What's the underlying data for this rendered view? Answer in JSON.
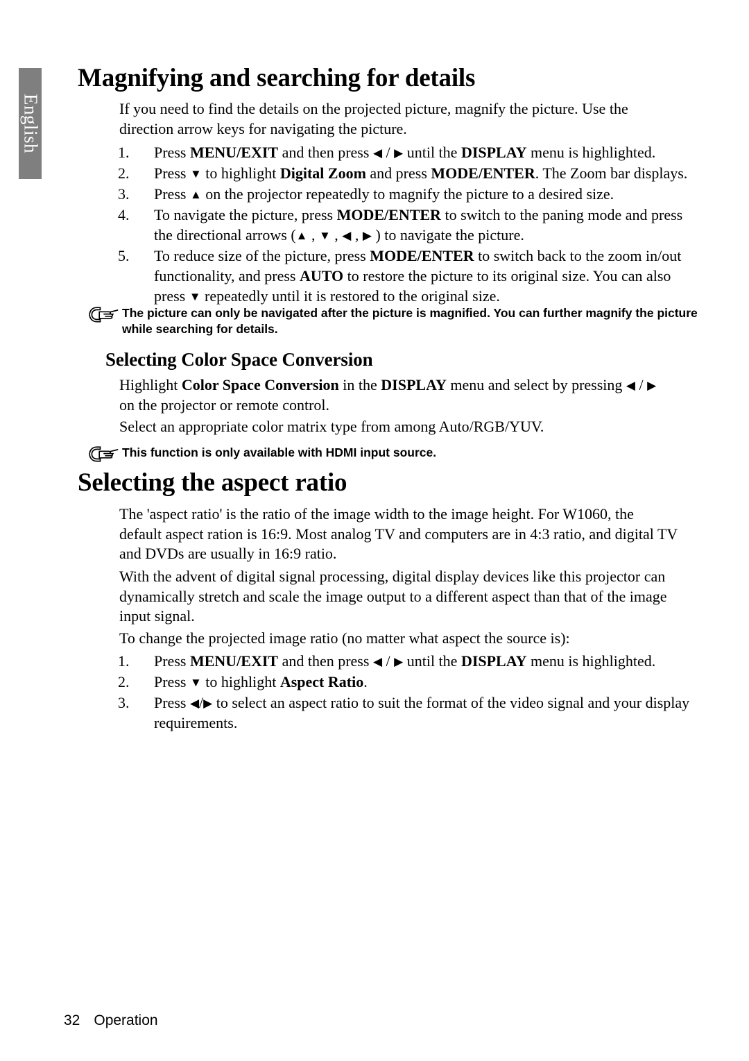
{
  "sidebar": {
    "language_tab": "English"
  },
  "sections": {
    "magnifying": {
      "heading": "Magnifying and searching for details",
      "intro": "If you need to find the details on the projected picture, magnify the picture. Use the direction arrow keys for navigating the picture.",
      "steps": [
        {
          "number": "1.",
          "parts": [
            {
              "t": "Press ",
              "b": false
            },
            {
              "t": "MENU/EXIT",
              "b": true
            },
            {
              "t": " and then press ",
              "b": false
            },
            {
              "t": "◀",
              "b": true,
              "arrow": true
            },
            {
              "t": " / ",
              "b": false
            },
            {
              "t": "▶",
              "b": true,
              "arrow": true
            },
            {
              "t": " until the ",
              "b": false
            },
            {
              "t": "DISPLAY",
              "b": true
            },
            {
              "t": " menu is highlighted.",
              "b": false
            }
          ]
        },
        {
          "number": "2.",
          "parts": [
            {
              "t": "Press ",
              "b": false
            },
            {
              "t": "▼",
              "b": true,
              "arrow": true
            },
            {
              "t": " to highlight ",
              "b": false
            },
            {
              "t": "Digital Zoom",
              "b": true
            },
            {
              "t": " and press ",
              "b": false
            },
            {
              "t": "MODE/ENTER",
              "b": true
            },
            {
              "t": ". The Zoom bar displays.",
              "b": false
            }
          ]
        },
        {
          "number": "3.",
          "parts": [
            {
              "t": "Press ",
              "b": false
            },
            {
              "t": "▲",
              "b": true,
              "arrow": true
            },
            {
              "t": " on the projector repeatedly to magnify the picture to a desired size.",
              "b": false
            }
          ]
        },
        {
          "number": "4.",
          "parts": [
            {
              "t": "To navigate the picture, press ",
              "b": false
            },
            {
              "t": "MODE/ENTER",
              "b": true
            },
            {
              "t": " to switch to the paning mode and press the directional arrows (",
              "b": false
            },
            {
              "t": "▲",
              "b": true,
              "arrow": true
            },
            {
              "t": " , ",
              "b": false
            },
            {
              "t": "▼",
              "b": true,
              "arrow": true
            },
            {
              "t": " , ",
              "b": false
            },
            {
              "t": "◀",
              "b": true,
              "arrow": true
            },
            {
              "t": " , ",
              "b": false
            },
            {
              "t": "▶",
              "b": true,
              "arrow": true
            },
            {
              "t": " ) to navigate the picture.",
              "b": false
            }
          ]
        },
        {
          "number": "5.",
          "parts": [
            {
              "t": "To reduce size of the picture, press ",
              "b": false
            },
            {
              "t": "MODE/ENTER",
              "b": true
            },
            {
              "t": " to switch back to the zoom in/out functionality, and press ",
              "b": false
            },
            {
              "t": "AUTO",
              "b": true
            },
            {
              "t": " to restore the picture to its original size. You can also press ",
              "b": false
            },
            {
              "t": "▼",
              "b": true,
              "arrow": true
            },
            {
              "t": " repeatedly until it is restored to the original size.",
              "b": false
            }
          ]
        }
      ],
      "note": "The picture can only be navigated after the picture is magnified. You can further magnify the picture while searching for details."
    },
    "color_space": {
      "heading": "Selecting Color Space Conversion",
      "paragraph_parts": [
        {
          "t": "Highlight ",
          "b": false
        },
        {
          "t": "Color Space Conversion",
          "b": true
        },
        {
          "t": " in the ",
          "b": false
        },
        {
          "t": "DISPLAY",
          "b": true
        },
        {
          "t": " menu and select by pressing ",
          "b": false
        },
        {
          "t": "◀",
          "b": true,
          "arrow": true
        },
        {
          "t": " / ",
          "b": false
        },
        {
          "t": "▶",
          "b": true,
          "arrow": true
        },
        {
          "t": "  on the projector or remote control.",
          "b": false
        }
      ],
      "paragraph2": "Select an appropriate color matrix type from among Auto/RGB/YUV.",
      "note": "This function is only available with HDMI input source."
    },
    "aspect_ratio": {
      "heading": "Selecting the aspect ratio",
      "paragraph1": "The 'aspect ratio' is the ratio of the image width to the image height. For W1060, the default aspect ration is 16:9. Most analog TV and computers are in 4:3 ratio, and digital TV and DVDs are usually in 16:9 ratio.",
      "paragraph2": "With the advent of digital signal processing, digital display devices like this projector can dynamically stretch and scale the image output to a different aspect than that of the image input signal.",
      "paragraph3": "To change the projected image ratio (no matter what aspect the source is):",
      "steps": [
        {
          "number": "1.",
          "parts": [
            {
              "t": "Press ",
              "b": false
            },
            {
              "t": "MENU/EXIT",
              "b": true
            },
            {
              "t": " and then press ",
              "b": false
            },
            {
              "t": "◀",
              "b": true,
              "arrow": true
            },
            {
              "t": " / ",
              "b": false
            },
            {
              "t": "▶",
              "b": true,
              "arrow": true
            },
            {
              "t": "  until the ",
              "b": false
            },
            {
              "t": "DISPLAY",
              "b": true
            },
            {
              "t": " menu is highlighted.",
              "b": false
            }
          ]
        },
        {
          "number": "2.",
          "parts": [
            {
              "t": "Press ",
              "b": false
            },
            {
              "t": "▼",
              "b": true,
              "arrow": true
            },
            {
              "t": " to highlight ",
              "b": false
            },
            {
              "t": "Aspect Ratio",
              "b": true
            },
            {
              "t": ".",
              "b": false
            }
          ]
        },
        {
          "number": "3.",
          "parts": [
            {
              "t": "Press ",
              "b": false
            },
            {
              "t": "◀",
              "b": true,
              "arrow": true
            },
            {
              "t": "/",
              "b": false
            },
            {
              "t": "▶",
              "b": true,
              "arrow": true
            },
            {
              "t": " to select an aspect ratio to suit the format of the video signal and your display requirements.",
              "b": false
            }
          ]
        }
      ]
    }
  },
  "footer": {
    "page_number": "32",
    "section_name": "Operation"
  }
}
